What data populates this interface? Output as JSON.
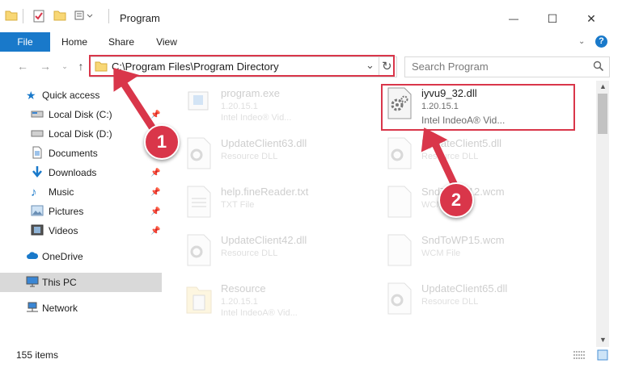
{
  "window": {
    "title": "Program",
    "minimize": "—",
    "maximize": "☐",
    "close": "✕"
  },
  "ribbon": {
    "tabs": [
      "File",
      "Home",
      "Share",
      "View"
    ],
    "help": "?"
  },
  "address": {
    "path": "C:\\Program Files\\Program Directory",
    "dropdown": "⌄",
    "refresh": "↻"
  },
  "search": {
    "placeholder": "Search Program"
  },
  "sidebar": {
    "items": [
      {
        "label": "Quick access",
        "icon": "star-icon"
      },
      {
        "label": "Local Disk (C:)",
        "icon": "drive-icon"
      },
      {
        "label": "Local Disk (D:)",
        "icon": "drive-icon"
      },
      {
        "label": "Documents",
        "icon": "documents-icon"
      },
      {
        "label": "Downloads",
        "icon": "download-icon"
      },
      {
        "label": "Music",
        "icon": "music-icon"
      },
      {
        "label": "Pictures",
        "icon": "pictures-icon"
      },
      {
        "label": "Videos",
        "icon": "videos-icon"
      },
      {
        "label": "OneDrive",
        "icon": "cloud-icon"
      },
      {
        "label": "This PC",
        "icon": "pc-icon"
      },
      {
        "label": "Network",
        "icon": "network-icon"
      }
    ]
  },
  "files": [
    {
      "name": "program.exe",
      "line1": "1.20.15.1",
      "line2": "Intel Indeo® Vid...",
      "icon": "exe-icon"
    },
    {
      "name": "iyvu9_32.dll",
      "line1": "1.20.15.1",
      "line2": "Intel IndeoA® Vid...",
      "icon": "dll-gear-icon"
    },
    {
      "name": "UpdateClient63.dll",
      "line1": "Resource DLL",
      "icon": "dll-gear-icon"
    },
    {
      "name": "UpdateClient5.dll",
      "line1": "Resource DLL",
      "icon": "dll-gear-icon"
    },
    {
      "name": "help.fineReader.txt",
      "line1": "TXT File",
      "icon": "text-file-icon"
    },
    {
      "name": "SndToWP12.wcm",
      "line1": "WCM File",
      "icon": "blank-file-icon"
    },
    {
      "name": "UpdateClient42.dll",
      "line1": "Resource DLL",
      "icon": "dll-gear-icon"
    },
    {
      "name": "SndToWP15.wcm",
      "line1": "WCM File",
      "icon": "blank-file-icon"
    },
    {
      "name": "Resource",
      "line1": "1.20.15.1",
      "line2": "Intel IndeoA® Vid...",
      "icon": "folder-file-icon"
    },
    {
      "name": "UpdateClient65.dll",
      "line1": "Resource DLL",
      "icon": "dll-gear-icon"
    }
  ],
  "status": {
    "items": "155 items"
  },
  "annotations": {
    "badge1": "1",
    "badge2": "2"
  },
  "colors": {
    "accent": "#1979ca",
    "highlight": "#d9364a"
  }
}
